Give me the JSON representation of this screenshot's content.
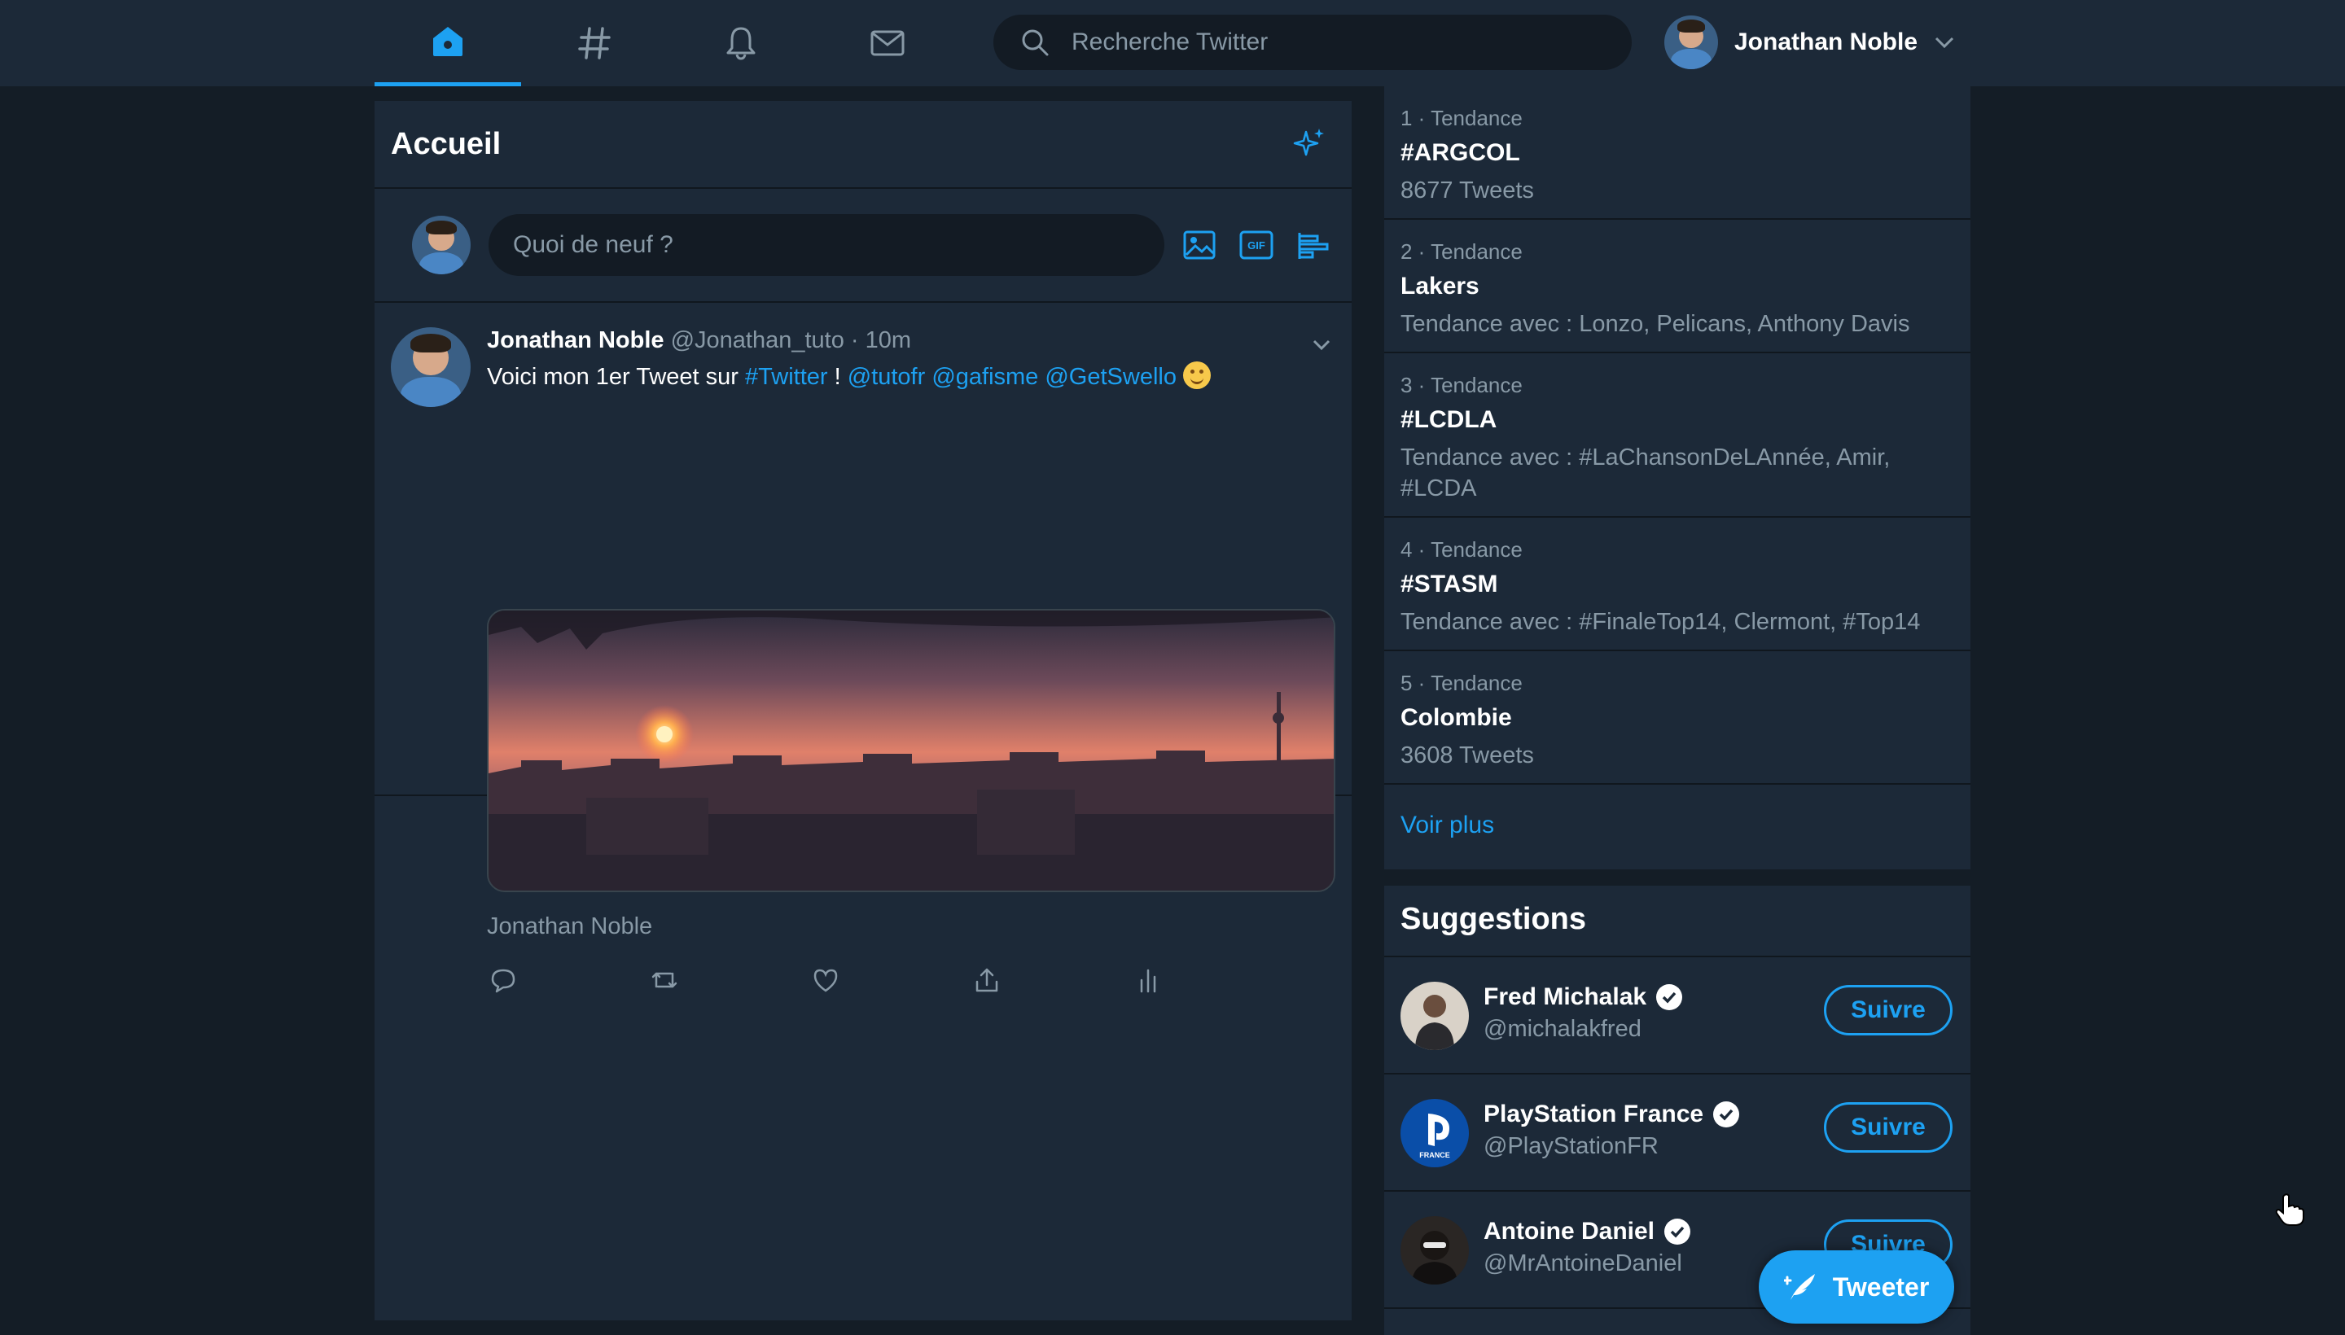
{
  "colors": {
    "background": "#141d26",
    "panel": "#1c2938",
    "accent": "#1da1f2",
    "muted_text": "#8899a6"
  },
  "nav": {
    "tabs": [
      {
        "icon": "home-icon",
        "active": true
      },
      {
        "icon": "hashtag-icon",
        "active": false
      },
      {
        "icon": "bell-icon",
        "active": false
      },
      {
        "icon": "mail-icon",
        "active": false
      }
    ]
  },
  "search": {
    "placeholder": "Recherche Twitter"
  },
  "account": {
    "name": "Jonathan Noble"
  },
  "main": {
    "title": "Accueil",
    "composer_placeholder": "Quoi de neuf ?",
    "composer_tools": [
      "image-icon",
      "gif-icon",
      "poll-icon"
    ]
  },
  "tweet": {
    "author": "Jonathan Noble",
    "meta": "@Jonathan_tuto · 10m",
    "text_prefix": "Voici mon 1er Tweet sur ",
    "hashtag": "#Twitter",
    "exclaim": " ! ",
    "mentions": [
      "@tutofr",
      "@gafisme",
      "@GetSwello"
    ],
    "media_caption": "Jonathan Noble",
    "actions": [
      "reply-icon",
      "retweet-icon",
      "like-icon",
      "share-icon",
      "analytics-icon"
    ]
  },
  "trends": {
    "items": [
      {
        "rank": "1 · Tendance",
        "tag": "#ARGCOL",
        "sub": "8677 Tweets"
      },
      {
        "rank": "2 · Tendance",
        "tag": "Lakers",
        "sub": "Tendance avec : Lonzo, Pelicans, Anthony Davis"
      },
      {
        "rank": "3 · Tendance",
        "tag": "#LCDLA",
        "sub": "Tendance avec : #LaChansonDeLAnnée, Amir, #LCDA"
      },
      {
        "rank": "4 · Tendance",
        "tag": "#STASM",
        "sub": "Tendance avec : #FinaleTop14, Clermont, #Top14"
      },
      {
        "rank": "5 · Tendance",
        "tag": "Colombie",
        "sub": "3608 Tweets"
      }
    ],
    "more_label": "Voir plus"
  },
  "suggestions": {
    "title": "Suggestions",
    "follow_label": "Suivre",
    "items": [
      {
        "name": "Fred Michalak",
        "handle": "@michalakfred",
        "verified": true
      },
      {
        "name": "PlayStation France",
        "handle": "@PlayStationFR",
        "verified": true,
        "avatar_text": "FRANCE"
      },
      {
        "name": "Antoine Daniel",
        "handle": "@MrAntoineDaniel",
        "verified": true
      }
    ]
  },
  "tweeter_button": {
    "label": "Tweeter"
  }
}
